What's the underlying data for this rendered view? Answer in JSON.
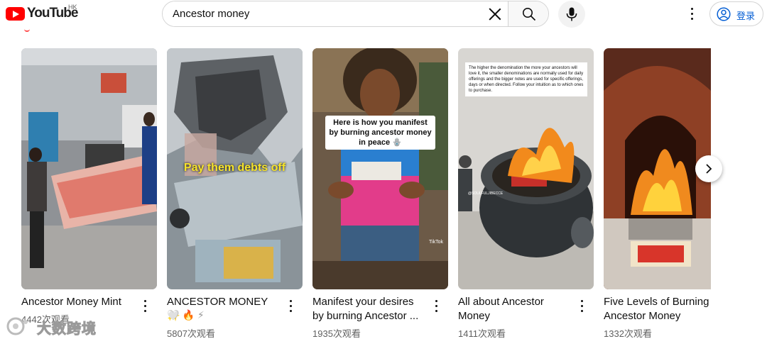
{
  "header": {
    "logo_text": "YouTube",
    "region": "HK",
    "search_value": "Ancestor money",
    "signin_label": "登录"
  },
  "shorts": [
    {
      "title": "Ancestor Money Mint",
      "views": "4442次观看"
    },
    {
      "title": "ANCESTOR MONEY ✨",
      "reactions": [
        "🤍",
        "🔥",
        "⚡"
      ],
      "views": "5807次观看",
      "overlay": "Pay them debts off"
    },
    {
      "title": "Manifest your desires by burning Ancestor ...",
      "views": "1935次观看",
      "overlay": "Here is how you manifest by burning ancestor money in peace 🪬",
      "badge": "TikTok"
    },
    {
      "title": "All about Ancestor Money",
      "views": "1411次观看",
      "overlay": "The higher the denomination the more your ancestors will love it, the smaller denominations are normally used for daily offerings and the bigger notes are used for specific offerings, days or when directed. Follow your intuition as to which ones to purchase.",
      "handle": "@SOULFULJIBECCE"
    },
    {
      "title": "Five Levels of Burning Ancestor Money",
      "views": "1332次观看"
    }
  ],
  "watermark": "大数跨境",
  "colors": {
    "brand_red": "#ff0000",
    "link_blue": "#065fd4",
    "meta_gray": "#606060"
  }
}
